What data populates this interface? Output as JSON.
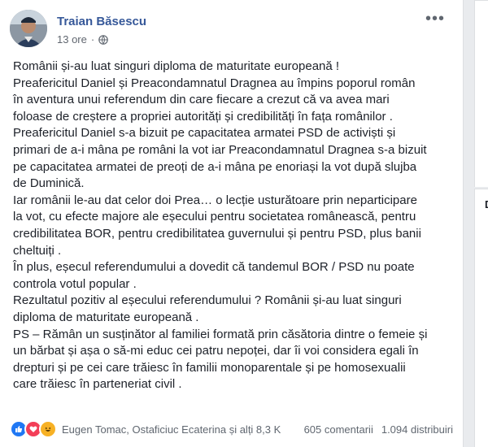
{
  "post": {
    "author": "Traian Băsescu",
    "time": "13 ore",
    "lines": [
      "Românii și-au luat singuri diploma de maturitate europeană !",
      "Preafericitul Daniel și Preacondamnatul Dragnea au împins poporul român",
      "în aventura unui referendum din care fiecare a crezut că va avea mari",
      "foloase de creștere a propriei autorități și credibilități în fața românilor .",
      "Preafericitul Daniel s-a bizuit pe capacitatea armatei PSD de activiști și",
      "primari de a-i mâna pe români la vot iar Preacondamnatul Dragnea s-a bizuit",
      "pe capacitatea armatei de preoți de a-i mâna pe enoriași la vot după slujba",
      "de Duminică.",
      "Iar românii le-au dat celor doi Prea… o lecție usturătoare prin neparticipare",
      "la vot, cu efecte majore ale eșecului pentru societatea românească, pentru",
      "credibilitatea BOR, pentru credibilitatea guvernului și pentru PSD, plus banii",
      "cheltuiți .",
      "În plus, eșecul referendumului a dovedit că tandemul BOR / PSD nu poate",
      "controla votul popular .",
      "Rezultatul pozitiv al eșecului referendumului ? Românii și-au luat singuri",
      "diploma de maturitate europeană .",
      "PS – Rămân un susținător al familiei formată prin căsătoria dintre o femeie și",
      "un bărbat și așa o să-mi educ cei patru nepoței, dar îi voi considera egali în",
      "drepturi și pe cei care trăiesc în familii monoparentale și pe homosexualii",
      "care trăiesc în parteneriat civil ."
    ],
    "reactions_text": "Eugen Tomac, Ostaficiuc Ecaterina și alți 8,3 K",
    "comments": "605 comentarii",
    "shares": "1.094 distribuiri",
    "icons": [
      "like-icon",
      "love-icon",
      "haha-icon",
      "globe-icon",
      "more-icon"
    ]
  },
  "side": {
    "letter": "D"
  },
  "colors": {
    "author": "#365899",
    "text": "#1d2129",
    "meta": "#616770",
    "like": "#2078f4",
    "love": "#f33e58",
    "haha": "#f7b125"
  }
}
